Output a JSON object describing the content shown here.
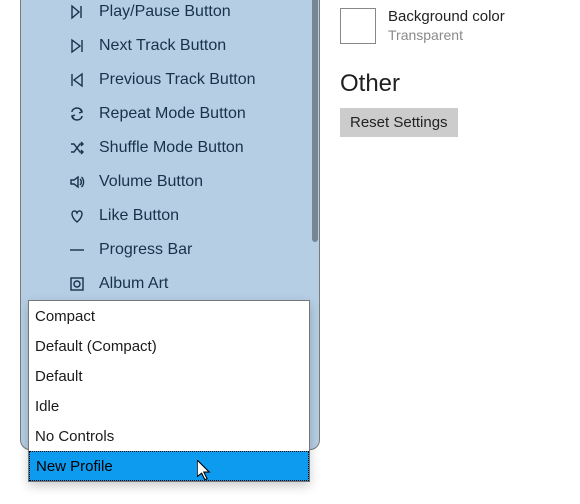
{
  "tree_items": [
    {
      "icon": "play-pause-icon",
      "label": "Play/Pause Button"
    },
    {
      "icon": "next-track-icon",
      "label": "Next Track Button"
    },
    {
      "icon": "previous-track-icon",
      "label": "Previous Track Button"
    },
    {
      "icon": "repeat-icon",
      "label": "Repeat Mode Button"
    },
    {
      "icon": "shuffle-icon",
      "label": "Shuffle Mode Button"
    },
    {
      "icon": "volume-icon",
      "label": "Volume Button"
    },
    {
      "icon": "heart-icon",
      "label": "Like Button"
    },
    {
      "icon": "progress-icon",
      "label": "Progress Bar"
    },
    {
      "icon": "album-art-icon",
      "label": "Album Art"
    }
  ],
  "right": {
    "bg_color_label": "Background color",
    "bg_color_value": "Transparent",
    "other_header": "Other",
    "reset_label": "Reset Settings"
  },
  "popup": {
    "items": [
      "Compact",
      "Default (Compact)",
      "Default",
      "Idle",
      "No Controls",
      "New Profile"
    ],
    "selected_index": 5
  }
}
